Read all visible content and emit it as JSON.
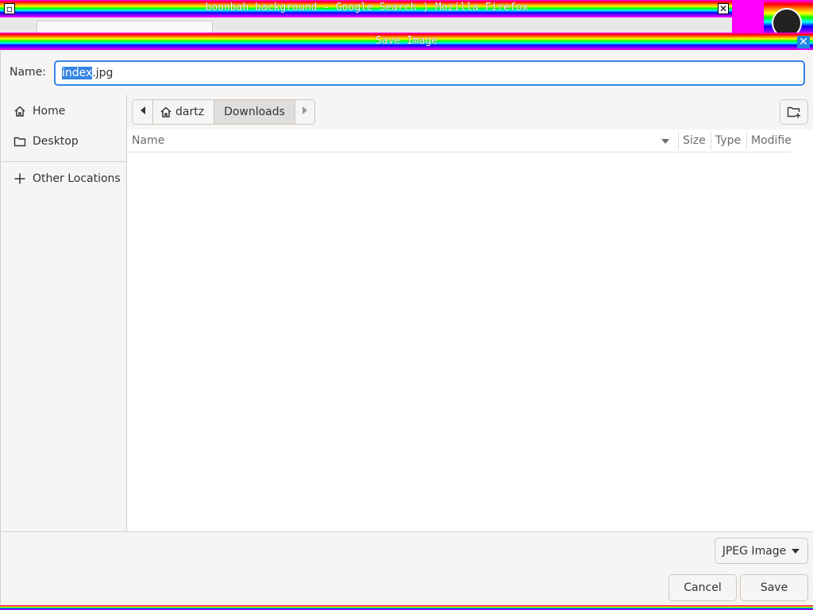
{
  "background_window": {
    "title": "boonbah background - Google Search ) Mozilla Firefox",
    "minimize_glyph": "▫",
    "close_glyph": "✕"
  },
  "dialog": {
    "title": "Save Image",
    "close_glyph": "✕",
    "name_label": "Name:",
    "name_value_selected": "index",
    "name_value_rest": ".jpg"
  },
  "sidebar": {
    "items": [
      {
        "label": "Home",
        "icon": "home-icon"
      },
      {
        "label": "Desktop",
        "icon": "folder-icon"
      },
      {
        "label": "Other Locations",
        "icon": "plus-icon"
      }
    ]
  },
  "pathbar": {
    "segments": [
      "dartz",
      "Downloads"
    ]
  },
  "filelist": {
    "columns": [
      "Name",
      "Size",
      "Type",
      "Modified"
    ],
    "rows": []
  },
  "footer": {
    "filetype": "JPEG Image",
    "cancel_label": "Cancel",
    "save_label": "Save"
  },
  "colors": {
    "accent": "#3584e4",
    "window_bg": "#f6f5f4"
  }
}
